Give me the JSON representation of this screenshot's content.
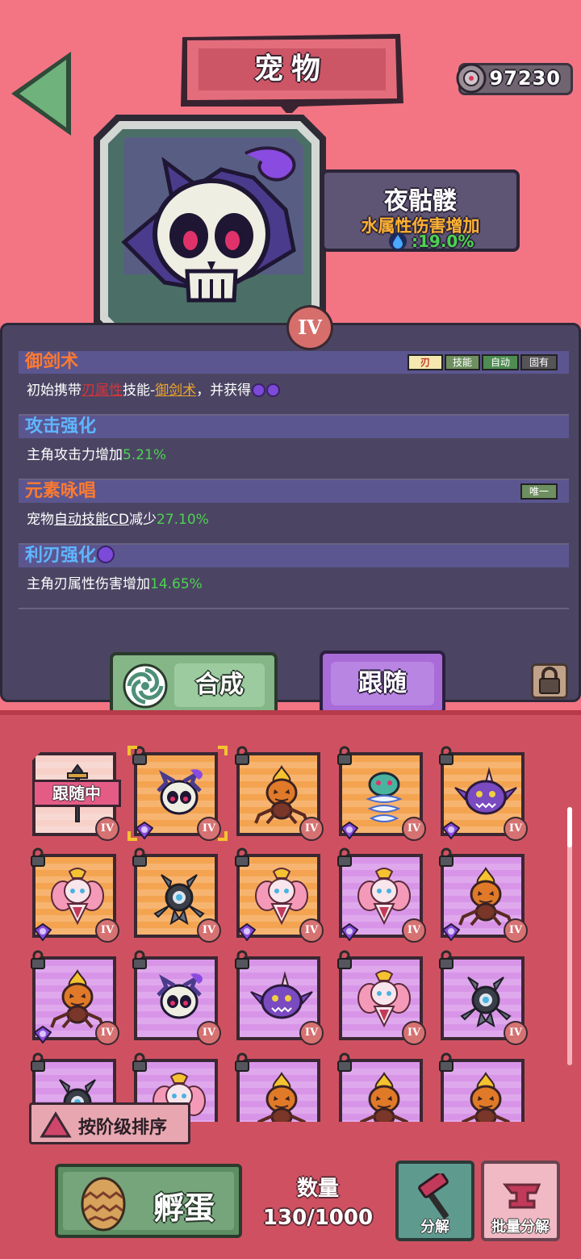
{
  "header": {
    "title": "宠物",
    "currency_value": "97230",
    "currency_icon": "gear-coin-icon"
  },
  "pet": {
    "name": "夜骷髅",
    "attribute": "水属性伤害增加",
    "attribute_value": ":19.0%",
    "rank": "IV"
  },
  "skills": [
    {
      "name": "御剑术",
      "name_color": "#ff7a2f",
      "tags": [
        "刃",
        "技能",
        "自动",
        "固有"
      ],
      "desc_parts": [
        "初始携带",
        "刃属性",
        "技能-",
        "御剑术",
        "，并获得"
      ]
    },
    {
      "name": "攻击强化",
      "name_color": "#5fb6ff",
      "desc": "主角攻击力增加",
      "value": "5.21%"
    },
    {
      "name": "元素咏唱",
      "name_color": "#ff7a2f",
      "tag": "唯一",
      "desc_pre": "宠物",
      "desc_u": "自动技能CD",
      "desc_post": "减少",
      "value": "27.10%"
    },
    {
      "name": "利刃强化",
      "name_color": "#5fb6ff",
      "desc": "主角刃属性伤害增加",
      "value": "14.65%"
    }
  ],
  "buttons": {
    "synthesize": "合成",
    "follow": "跟随",
    "sort": "按阶级排序",
    "hatch": "孵蛋",
    "decompose": "分解",
    "batch_decompose": "批量分解"
  },
  "following_label": "跟随中",
  "grid_rank_label": "IV",
  "count": {
    "label": "数量",
    "value": "130/1000"
  },
  "pets_grid": [
    {
      "creature": "sword-spirit",
      "bg": "orange",
      "following": true,
      "gem": false
    },
    {
      "creature": "skull",
      "bg": "orange",
      "following": false,
      "gem": true,
      "selected": true
    },
    {
      "creature": "pumpkin-spider",
      "bg": "orange",
      "following": false,
      "gem": false
    },
    {
      "creature": "ghost-spring",
      "bg": "orange",
      "following": false,
      "gem": true
    },
    {
      "creature": "purple-blob",
      "bg": "orange",
      "following": false,
      "gem": true
    },
    {
      "creature": "flower-fairy",
      "bg": "orange",
      "following": false,
      "gem": true
    },
    {
      "creature": "eye-drone",
      "bg": "orange",
      "following": false,
      "gem": false
    },
    {
      "creature": "flower-fairy",
      "bg": "orange",
      "following": false,
      "gem": true
    },
    {
      "creature": "flower-fairy",
      "bg": "purple",
      "following": false,
      "gem": true
    },
    {
      "creature": "pumpkin-spider",
      "bg": "purple",
      "following": false,
      "gem": true
    },
    {
      "creature": "pumpkin-spider",
      "bg": "purple",
      "following": false,
      "gem": true
    },
    {
      "creature": "skull",
      "bg": "purple",
      "following": false,
      "gem": false
    },
    {
      "creature": "purple-blob",
      "bg": "purple",
      "following": false,
      "gem": false
    },
    {
      "creature": "flower-fairy",
      "bg": "purple",
      "following": false,
      "gem": false
    },
    {
      "creature": "eye-drone",
      "bg": "purple",
      "following": false,
      "gem": false
    },
    {
      "creature": "eye-drone",
      "bg": "purple",
      "following": false,
      "gem": false
    },
    {
      "creature": "flower-fairy",
      "bg": "purple",
      "following": false,
      "gem": false
    },
    {
      "creature": "pumpkin-spider",
      "bg": "purple",
      "following": false,
      "gem": false
    },
    {
      "creature": "pumpkin-spider",
      "bg": "purple",
      "following": false,
      "gem": false
    },
    {
      "creature": "pumpkin-spider",
      "bg": "purple",
      "following": false,
      "gem": false
    }
  ]
}
